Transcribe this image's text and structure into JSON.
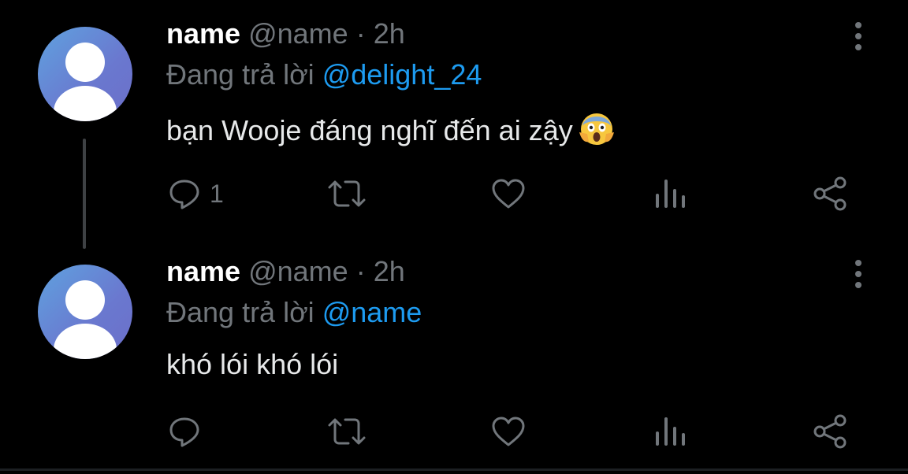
{
  "tweets": [
    {
      "name": "name",
      "handle": "@name",
      "dot": "·",
      "time": "2h",
      "replying_prefix": "Đang trả lời ",
      "replying_to": "@delight_24",
      "text": "bạn Wooje đáng nghĩ đến ai zậy",
      "emoji": "screaming-face-emoji",
      "reply_count": "1"
    },
    {
      "name": "name",
      "handle": "@name",
      "dot": "·",
      "time": "2h",
      "replying_prefix": "Đang trả lời ",
      "replying_to": "@name",
      "text": "khó lói khó lói",
      "reply_count": ""
    }
  ],
  "colors": {
    "background": "#000000",
    "primary_text": "#e7e9ea",
    "secondary_text": "#71767b",
    "mention": "#1d9bf0",
    "avatar_gradient_start": "#5fa2df",
    "avatar_gradient_end": "#6c6fc9"
  },
  "icons": [
    "avatar-placeholder-icon",
    "more-options-icon",
    "reply-icon",
    "retweet-icon",
    "like-icon",
    "views-icon",
    "share-icon"
  ]
}
